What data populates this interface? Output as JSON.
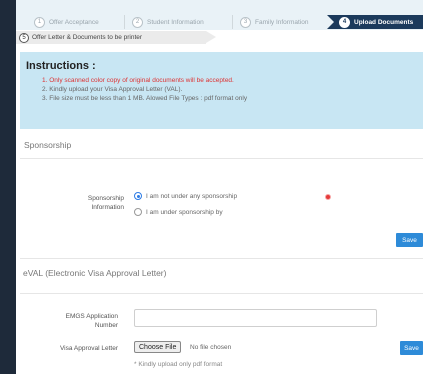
{
  "stepper": {
    "steps": [
      {
        "num": "1",
        "label": "Offer Acceptance"
      },
      {
        "num": "2",
        "label": "Student Information"
      },
      {
        "num": "3",
        "label": "Family Information"
      },
      {
        "num": "4",
        "label": "Upload Documents"
      }
    ],
    "sub_step": {
      "num": "5",
      "label": "Offer Letter & Documents to be printer"
    }
  },
  "instructions": {
    "title": "Instructions :",
    "items": [
      "1. Only scanned color copy of original documents will be accepted.",
      "2. Kindly upload your Visa Approval Letter (VAL).",
      "3. File size must be less than 1 MB. Alowed File Types : pdf format only"
    ]
  },
  "sponsorship": {
    "section_title": "Sponsorship",
    "field_label_line1": "Sponsorship",
    "field_label_line2": "Information",
    "options": [
      {
        "label": "I am not under any sponsorship",
        "checked": true
      },
      {
        "label": "I am under sponsorship by",
        "checked": false
      }
    ],
    "save_label": "Save"
  },
  "eval": {
    "section_title": "eVAL (Electronic Visa Approval Letter)",
    "emgs_label_line1": "EMGS Application",
    "emgs_label_line2": "Number",
    "emgs_value": "",
    "visa_label": "Visa Approval Letter",
    "choose_file_label": "Choose File",
    "no_file_text": "No file chosen",
    "hint": "* Kindly upload only pdf format",
    "save_label": "Save"
  },
  "colors": {
    "accent": "#2e8bd8",
    "active_step": "#1b3a5c",
    "instruction_bg": "#c8e6f3",
    "required": "#e53b3b"
  }
}
